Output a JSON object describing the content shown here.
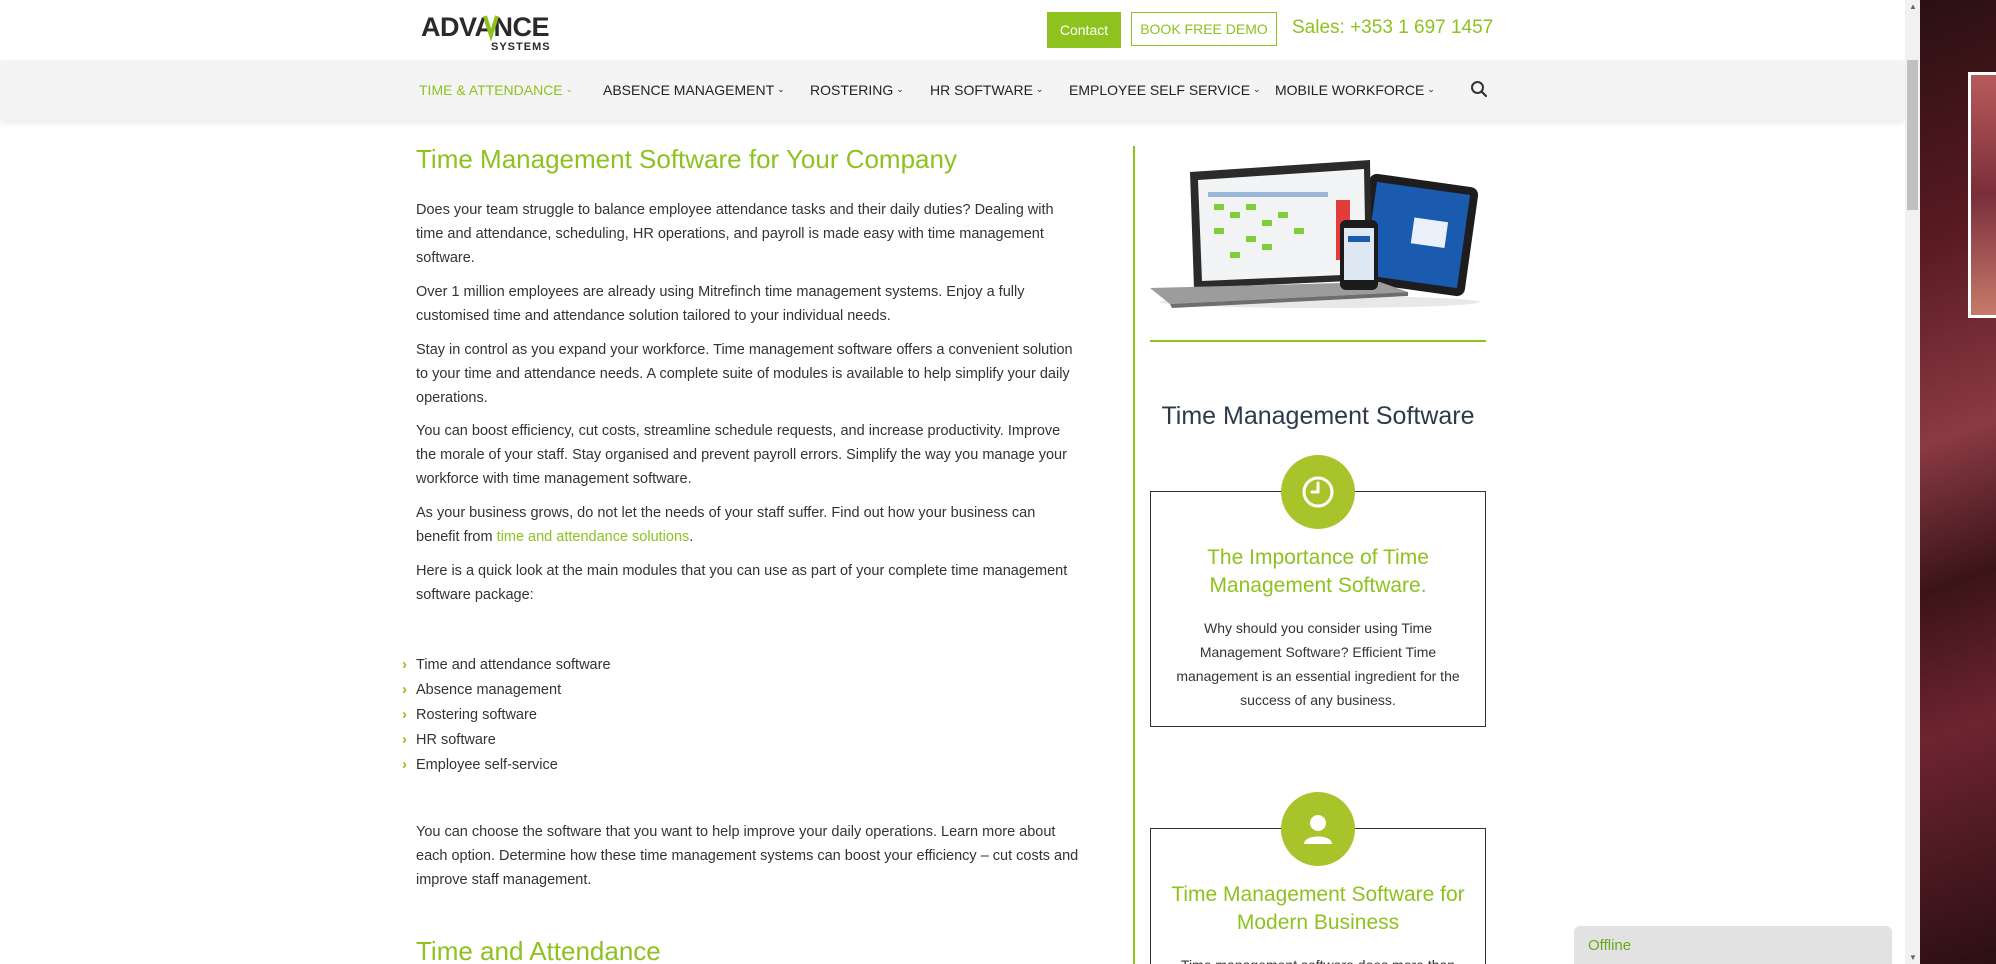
{
  "header": {
    "logo_text": "ADVANCE",
    "logo_sub": "SYSTEMS",
    "contact_label": "Contact",
    "demo_label": "BOOK FREE DEMO",
    "sales_text": "Sales: +353 1 697 1457"
  },
  "nav": {
    "items": [
      {
        "label": "TIME & ATTENDANCE",
        "active": true
      },
      {
        "label": "ABSENCE MANAGEMENT"
      },
      {
        "label": "ROSTERING"
      },
      {
        "label": "HR SOFTWARE"
      },
      {
        "label": "EMPLOYEE SELF SERVICE"
      },
      {
        "label": "MOBILE WORKFORCE"
      }
    ],
    "search_icon": "search-icon"
  },
  "main": {
    "title": "Time Management Software for Your Company",
    "paragraphs": [
      "Does your team struggle to balance employee attendance tasks and their daily duties? Dealing with time and attendance, scheduling, HR operations, and payroll is made easy with time management software.",
      "Over 1 million employees are already using Mitrefinch time management systems. Enjoy a fully customised time and attendance solution tailored to your individual needs.",
      "Stay in control as you expand your workforce. Time management software offers a convenient solution to your time and attendance needs. A complete suite of modules is available to help simplify your daily operations.",
      "You can boost efficiency, cut costs, streamline schedule requests, and increase productivity. Improve the morale of your staff. Stay organised and prevent payroll errors. Simplify the way you manage your workforce with time management software.",
      "As your business grows, do not let the needs of your staff suffer. Find out how your business can benefit from",
      "Here is a quick look at the main modules that you can use as part of your complete time management software package:",
      "You can choose the software that you want to help improve your daily operations. Learn more about each option. Determine how these time management systems can boost your efficiency – cut costs and improve staff management."
    ],
    "link_text": "time and attendance solutions",
    "link_suffix": ".",
    "modules": [
      "Time and attendance software",
      "Absence management",
      "Rostering software",
      "HR software",
      "Employee self-service"
    ],
    "section_title": "Time and Attendance"
  },
  "sidebar": {
    "title": "Time Management Software",
    "cards": [
      {
        "icon": "clock-icon",
        "title": "The Importance of Time Management Software.",
        "text": "Why should you consider using Time Management Software? Efficient Time management is an essential ingredient for the success of any business."
      },
      {
        "icon": "user-icon",
        "title": "Time Management Software for Modern Business",
        "text": "Time management software does more than"
      }
    ]
  },
  "chat": {
    "status": "Offline"
  },
  "colors": {
    "accent": "#8dc21f",
    "icon_circle": "#a8c42a",
    "heading_dark": "#2e3a4a"
  }
}
